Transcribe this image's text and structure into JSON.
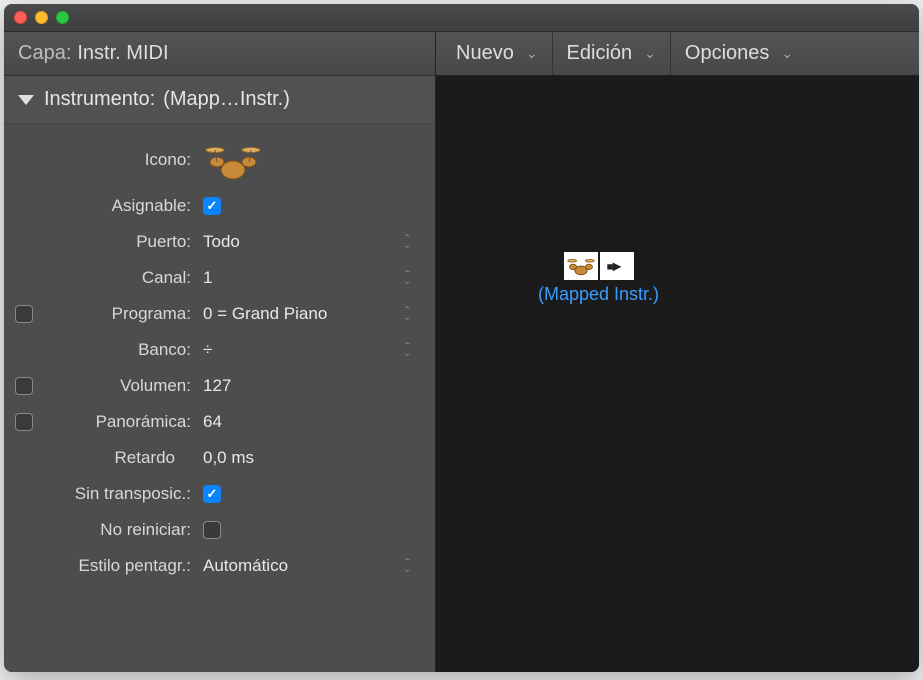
{
  "header": {
    "layer_label": "Capa:",
    "layer_value": "Instr. MIDI"
  },
  "section": {
    "title_label": "Instrumento:",
    "title_value": "(Mapp…Instr.)"
  },
  "rows": {
    "icono_label": "Icono:",
    "asignable_label": "Asignable:",
    "asignable_checked": true,
    "puerto_label": "Puerto:",
    "puerto_value": "Todo",
    "canal_label": "Canal:",
    "canal_value": "1",
    "programa_label": "Programa:",
    "programa_value": "0 = Grand Piano",
    "programa_checked": false,
    "banco_label": "Banco:",
    "banco_value": "÷",
    "volumen_label": "Volumen:",
    "volumen_value": "127",
    "volumen_checked": false,
    "panoramica_label": "Panorámica:",
    "panoramica_value": "64",
    "panoramica_checked": false,
    "retardo_label": "Retardo",
    "retardo_value": "0,0 ms",
    "transpos_label": "Sin transposic.:",
    "transpos_checked": true,
    "noreiniciar_label": "No reiniciar:",
    "noreiniciar_checked": false,
    "pentagr_label": "Estilo pentagr.:",
    "pentagr_value": "Automático"
  },
  "toolbar": {
    "nuevo": "Nuevo",
    "edicion": "Edición",
    "opciones": "Opciones"
  },
  "canvas": {
    "node_label": "(Mapped Instr.)"
  }
}
